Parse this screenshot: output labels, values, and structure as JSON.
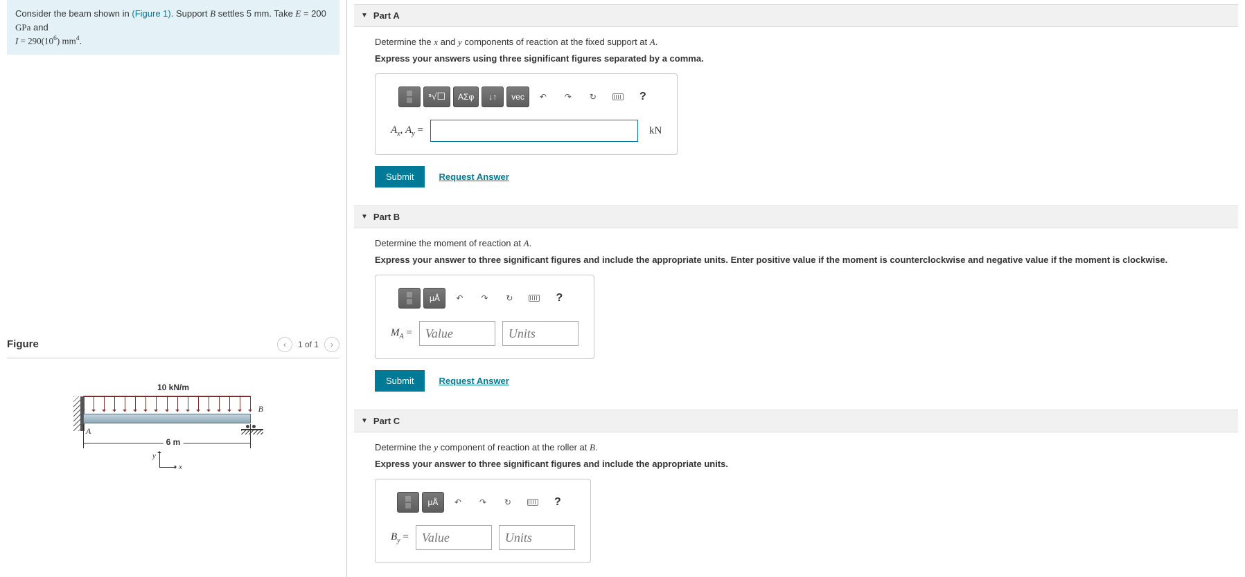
{
  "problem": {
    "text_prefix": "Consider the beam shown in ",
    "figure_link": "(Figure 1)",
    "text_mid1": ". Support ",
    "support_var": "B",
    "text_mid2": " settles 5 mm. Take ",
    "e_var": "E",
    "e_eq": " = 200 ",
    "e_unit": "GPa",
    "text_and": " and ",
    "i_var": "I",
    "i_eq": " = 290(10",
    "i_sup": "6",
    "i_eq2": ") mm",
    "i_sup2": "4",
    "period": "."
  },
  "figure_panel": {
    "title": "Figure",
    "counter": "1 of 1"
  },
  "diagram": {
    "load": "10 kN/m",
    "span": "6 m",
    "pt_a": "A",
    "pt_b": "B",
    "y": "y",
    "x": "x"
  },
  "parts": {
    "a": {
      "title": "Part A",
      "instr_pre": "Determine the ",
      "instr_x": "x",
      "instr_mid": " and ",
      "instr_y": "y",
      "instr_post": " components of reaction at the fixed support at ",
      "instr_pt": "A",
      "instr_end": ".",
      "instr2": "Express your answers using three significant figures separated by a comma.",
      "lhs_a": "A",
      "lhs_x": "x",
      "lhs_sep": ", ",
      "lhs_y": "y",
      "lhs_eq": " =",
      "unit": "kN"
    },
    "b": {
      "title": "Part B",
      "instr_pre": "Determine the moment of reaction at ",
      "instr_pt": "A",
      "instr_end": ".",
      "instr2": "Express your answer to three significant figures and include the appropriate units. Enter positive value if the moment is counterclockwise and negative value if the moment is clockwise.",
      "lhs_m": "M",
      "lhs_sub": "A",
      "lhs_eq": " =",
      "value_ph": "Value",
      "units_ph": "Units"
    },
    "c": {
      "title": "Part C",
      "instr_pre": "Determine the ",
      "instr_y": "y",
      "instr_mid": " component of reaction at the roller at ",
      "instr_pt": "B",
      "instr_end": ".",
      "instr2": "Express your answer to three significant figures and include the appropriate units.",
      "lhs_b": "B",
      "lhs_sub": "y",
      "lhs_eq": " =",
      "value_ph": "Value",
      "units_ph": "Units"
    }
  },
  "toolbar": {
    "greek": "ΑΣφ",
    "subsup": "↓↑",
    "vec": "vec",
    "undo": "↶",
    "redo": "↷",
    "reset": "↻",
    "help": "?",
    "units_btn": "μÅ"
  },
  "buttons": {
    "submit": "Submit",
    "request": "Request Answer"
  }
}
